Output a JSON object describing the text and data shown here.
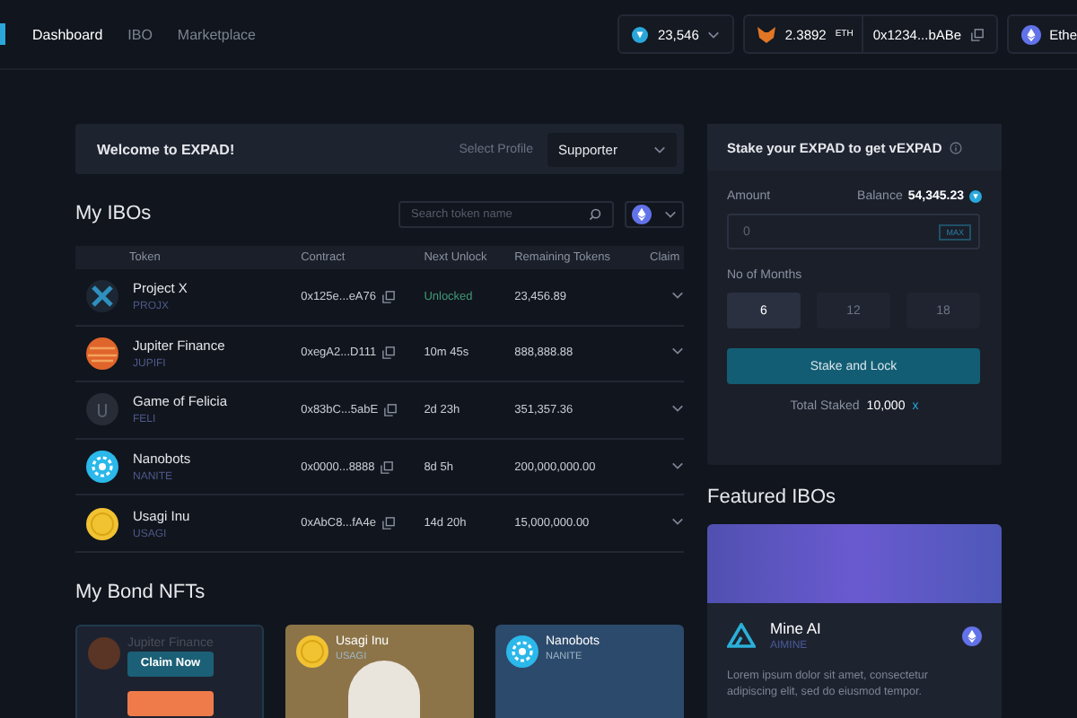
{
  "nav": {
    "items": [
      {
        "label": "Dashboard",
        "selected": true
      },
      {
        "label": "IBO",
        "selected": false
      },
      {
        "label": "Marketplace",
        "selected": false
      }
    ]
  },
  "header": {
    "balance": "23,546",
    "eth_amount": "2.3892",
    "eth_unit": "ETH",
    "wallet": "0x1234...bABe",
    "network": "Ethe"
  },
  "welcome": {
    "title": "Welcome to EXPAD!",
    "profile_label": "Select Profile",
    "profile_value": "Supporter"
  },
  "ibos": {
    "title": "My IBOs",
    "search_placeholder": "Search token name",
    "columns": [
      "Token",
      "Contract",
      "Next Unlock",
      "Remaining Tokens",
      "Claim"
    ],
    "rows": [
      {
        "name": "Project X",
        "symbol": "PROJX",
        "contract": "0x125e...eA76",
        "next_unlock": "Unlocked",
        "unlocked": true,
        "remaining": "23,456.89"
      },
      {
        "name": "Jupiter Finance",
        "symbol": "JUPIFI",
        "contract": "0xegA2...D111",
        "next_unlock": "10m 45s",
        "unlocked": false,
        "remaining": "888,888.88"
      },
      {
        "name": "Game of Felicia",
        "symbol": "FELI",
        "contract": "0x83bC...5abE",
        "next_unlock": "2d 23h",
        "unlocked": false,
        "remaining": "351,357.36"
      },
      {
        "name": "Nanobots",
        "symbol": "NANITE",
        "contract": "0x0000...8888",
        "next_unlock": "8d 5h",
        "unlocked": false,
        "remaining": "200,000,000.00"
      },
      {
        "name": "Usagi Inu",
        "symbol": "USAGI",
        "contract": "0xAbC8...fA4e",
        "next_unlock": "14d 20h",
        "unlocked": false,
        "remaining": "15,000,000.00"
      }
    ]
  },
  "bond_nfts": {
    "title": "My Bond NFTs",
    "cards": [
      {
        "name": "Jupiter Finance",
        "claimable": true,
        "claim_label": "Claim Now"
      },
      {
        "name": "Usagi Inu",
        "symbol": "USAGI",
        "claimable": false
      },
      {
        "name": "Nanobots",
        "symbol": "NANITE",
        "claimable": false
      }
    ]
  },
  "stake": {
    "title": "Stake your EXPAD to get vEXPAD",
    "amount_label": "Amount",
    "balance_label": "Balance",
    "balance": "54,345.23",
    "amount_placeholder": "0",
    "max_label": "MAX",
    "months_label": "No of Months",
    "months": [
      {
        "label": "6",
        "selected": true
      },
      {
        "label": "12",
        "selected": false
      },
      {
        "label": "18",
        "selected": false
      }
    ],
    "button": "Stake and Lock",
    "total_label": "Total Staked",
    "total": "10,000",
    "total_unit": "x"
  },
  "featured": {
    "title": "Featured IBOs",
    "card": {
      "name": "Mine AI",
      "symbol": "AIMINE",
      "description": "Lorem ipsum dolor sit amet, consectetur adipiscing elit, sed do eiusmod tempor."
    }
  }
}
